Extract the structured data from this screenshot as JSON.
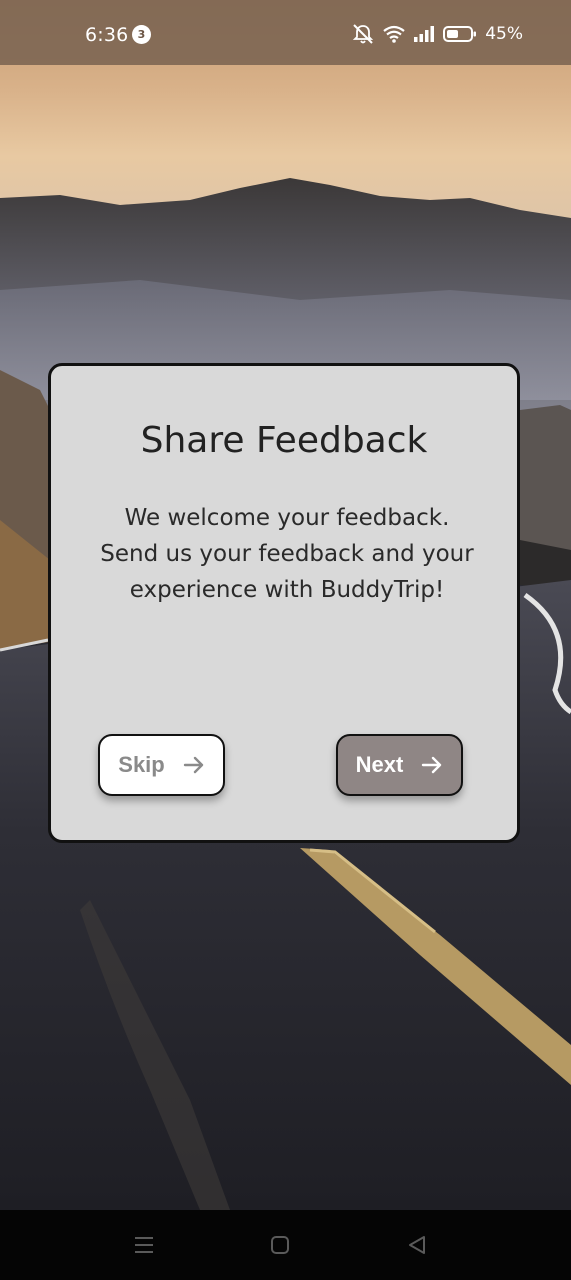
{
  "status_bar": {
    "time": "6:36",
    "notification_count": "3",
    "battery": "45%",
    "icons": [
      "mute-icon",
      "wifi-icon",
      "signal-icon",
      "battery-icon"
    ]
  },
  "dialog": {
    "title": "Share Feedback",
    "body_lines": [
      "We welcome your feedback.",
      "Send us your feedback and your",
      "experience with BuddyTrip!"
    ],
    "skip_label": "Skip",
    "next_label": "Next"
  },
  "nav_bar": {
    "buttons": [
      "menu-icon",
      "home-icon",
      "back-icon"
    ]
  },
  "colors": {
    "dialog_bg": "#d9d9d9",
    "next_button_bg": "#8f8685",
    "skip_button_bg": "#ffffff",
    "status_bar_bg": "#786250"
  }
}
